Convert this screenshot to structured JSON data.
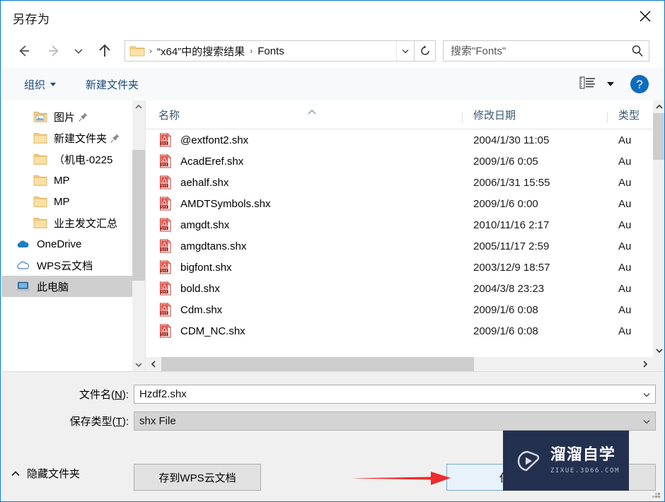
{
  "window": {
    "title": "另存为",
    "close_label": "✕"
  },
  "address": {
    "back_icon": "arrow-left-icon",
    "forward_icon": "arrow-right-icon",
    "recent_icon": "chevron-down-icon",
    "up_icon": "arrow-up-icon",
    "folder_icon": "folder-icon",
    "crumbs": [
      "“x64”中的搜索结果",
      "Fonts"
    ],
    "separator": "›",
    "dropdown_icon": "chevron-down-icon",
    "refresh_icon": "refresh-icon"
  },
  "search": {
    "placeholder": "搜索\"Fonts\"",
    "value": "",
    "icon": "search-icon"
  },
  "toolbar": {
    "organize_label": "组织",
    "newfolder_label": "新建文件夹",
    "view_icon": "list-view-icon",
    "view_caret_icon": "chevron-down-icon",
    "help_icon": "help-icon",
    "help_glyph": "?"
  },
  "navpane": {
    "items": [
      {
        "label": "图片",
        "icon": "pictures-folder-icon",
        "pinned": true,
        "indent": 1,
        "selected": false
      },
      {
        "label": "新建文件夹",
        "icon": "folder-icon",
        "pinned": true,
        "indent": 1,
        "selected": false
      },
      {
        "label": "（机电-0225",
        "icon": "folder-icon",
        "pinned": false,
        "indent": 1,
        "selected": false
      },
      {
        "label": "MP",
        "icon": "folder-icon",
        "pinned": false,
        "indent": 1,
        "selected": false
      },
      {
        "label": "MP",
        "icon": "folder-icon",
        "pinned": false,
        "indent": 1,
        "selected": false
      },
      {
        "label": "业主发文汇总",
        "icon": "folder-icon",
        "pinned": false,
        "indent": 1,
        "selected": false
      },
      {
        "label": "OneDrive",
        "icon": "onedrive-cloud-icon",
        "pinned": false,
        "indent": 0,
        "selected": false
      },
      {
        "label": "WPS云文档",
        "icon": "wps-cloud-icon",
        "pinned": false,
        "indent": 0,
        "selected": false
      },
      {
        "label": "此电脑",
        "icon": "this-pc-icon",
        "pinned": false,
        "indent": 0,
        "selected": true
      }
    ],
    "scroll_up_icon": "chevron-up-icon",
    "scroll_down_icon": "chevron-down-icon"
  },
  "filelist": {
    "columns": [
      {
        "key": "name",
        "label": "名称"
      },
      {
        "key": "date",
        "label": "修改日期"
      },
      {
        "key": "type",
        "label": "类型"
      }
    ],
    "sort_indicator": "⌃",
    "sort_column": "名称",
    "rows": [
      {
        "name": "@extfont2.shx",
        "date": "2004/1/30 11:05",
        "type": "Au",
        "icon": "shx-file-icon"
      },
      {
        "name": "AcadEref.shx",
        "date": "2009/1/6 0:05",
        "type": "Au",
        "icon": "shx-file-icon"
      },
      {
        "name": "aehalf.shx",
        "date": "2006/1/31 15:55",
        "type": "Au",
        "icon": "shx-file-icon"
      },
      {
        "name": "AMDTSymbols.shx",
        "date": "2009/1/6 0:00",
        "type": "Au",
        "icon": "shx-file-icon"
      },
      {
        "name": "amgdt.shx",
        "date": "2010/11/16 2:17",
        "type": "Au",
        "icon": "shx-file-icon"
      },
      {
        "name": "amgdtans.shx",
        "date": "2005/11/17 2:59",
        "type": "Au",
        "icon": "shx-file-icon"
      },
      {
        "name": "bigfont.shx",
        "date": "2003/12/9 18:57",
        "type": "Au",
        "icon": "shx-file-icon"
      },
      {
        "name": "bold.shx",
        "date": "2004/3/8 23:23",
        "type": "Au",
        "icon": "shx-file-icon"
      },
      {
        "name": "Cdm.shx",
        "date": "2009/1/6 0:08",
        "type": "Au",
        "icon": "shx-file-icon"
      },
      {
        "name": "CDM_NC.shx",
        "date": "2009/1/6 0:08",
        "type": "Au",
        "icon": "shx-file-icon"
      }
    ],
    "hscroll_left_icon": "chevron-left-icon",
    "hscroll_right_icon": "chevron-right-icon",
    "vscroll_up_icon": "chevron-up-icon",
    "vscroll_down_icon": "chevron-down-icon"
  },
  "form": {
    "filename_label": "文件名(N):",
    "filename_label_pre": "文件名(",
    "filename_label_key": "N",
    "filename_label_post": "):",
    "filename_value": "Hzdf2.shx",
    "filetype_label_pre": "保存类型(",
    "filetype_label_key": "T",
    "filetype_label_post": "):",
    "filetype_value": "shx File",
    "dropdown_icon": "chevron-down-icon"
  },
  "footer": {
    "hide_folders_label": "隐藏文件夹",
    "hide_folders_icon": "chevron-up-icon",
    "wps_button_label": "存到WPS云文档",
    "save_button_label": "保存(",
    "cancel_button_label": "",
    "resize_grip_icon": "resize-grip-icon"
  },
  "annotation": {
    "arrow_color": "#ef2b2b",
    "arrow_icon": "red-arrow-pointer"
  },
  "watermark": {
    "brand_cn": "溜溜自学",
    "brand_url": "ZIXUE.3D66.COM",
    "logo_icon": "play-triangle-icon",
    "background": "#24304f"
  }
}
